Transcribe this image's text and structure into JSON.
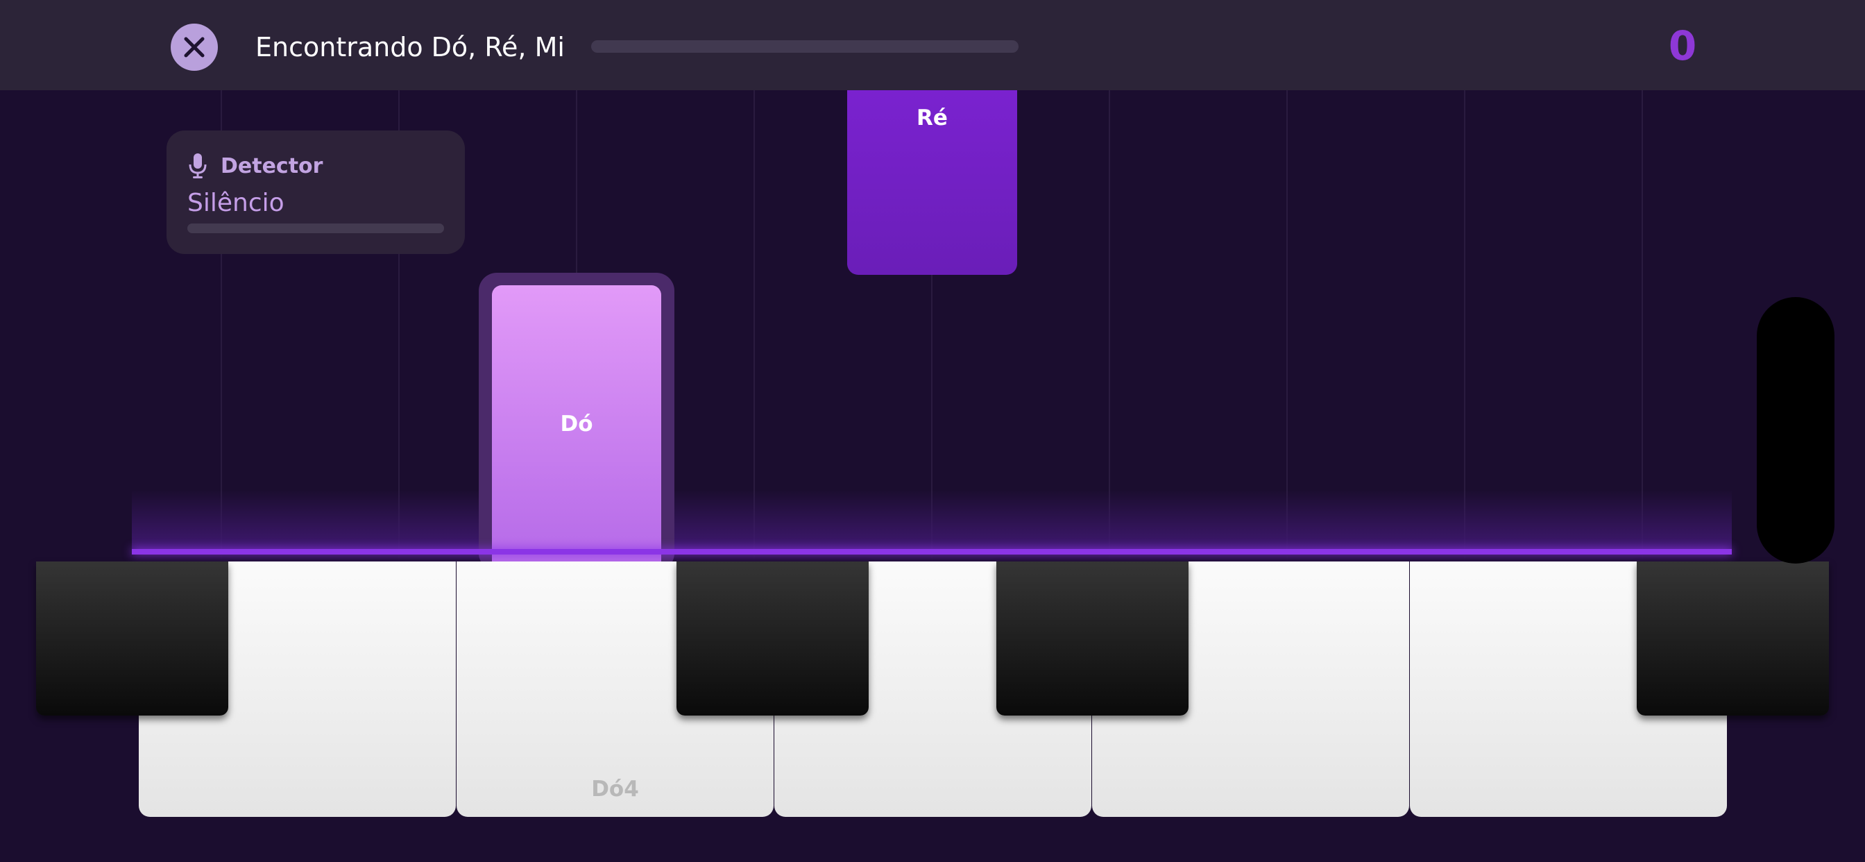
{
  "header": {
    "title": "Encontrando Dó, Ré, Mi",
    "progress": 0,
    "score": "0"
  },
  "detector": {
    "title": "Detector",
    "status": "Silêncio",
    "level": 0
  },
  "notes": [
    {
      "label": "Dó",
      "color": "#d98cf4",
      "state": "active"
    },
    {
      "label": "Ré",
      "color": "#7423c8",
      "state": "falling"
    }
  ],
  "keyboard": {
    "white_keys": [
      {
        "label": ""
      },
      {
        "label": "Dó4"
      },
      {
        "label": ""
      },
      {
        "label": ""
      },
      {
        "label": ""
      }
    ],
    "black_key_count": 4
  },
  "colors": {
    "accent": "#8b35e6",
    "background": "#1b0d2f",
    "score": "#8e38d6",
    "close_button": "#b9a0dc"
  },
  "icons": {
    "close": "close-icon",
    "detector": "microphone-icon"
  }
}
